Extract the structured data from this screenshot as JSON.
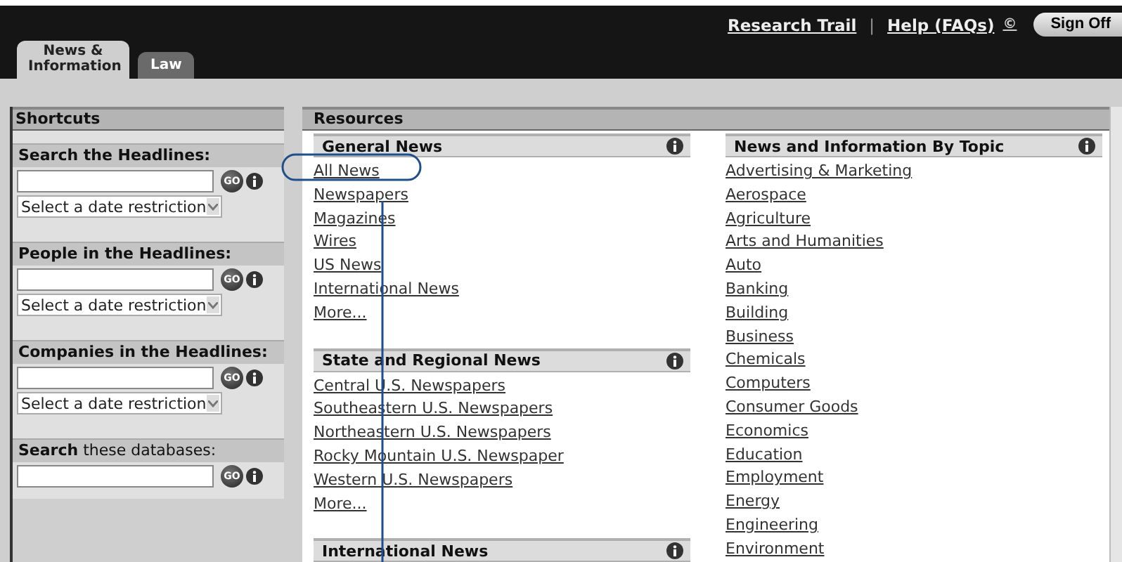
{
  "header": {
    "links": [
      {
        "label": "Research Trail"
      },
      {
        "label": "Help (FAQs)"
      }
    ],
    "separator": "|",
    "help_mark": "©",
    "sign_off": "Sign Off"
  },
  "tabs": [
    {
      "label": "News & Information",
      "selected": true
    },
    {
      "label": "Law",
      "selected": false
    }
  ],
  "shortcuts": {
    "title": "Shortcuts",
    "sections": [
      {
        "label": "Search the Headlines:",
        "go": "GO",
        "date_select": "Select a date restriction"
      },
      {
        "label": "People in the Headlines:",
        "go": "GO",
        "date_select": "Select a date restriction"
      },
      {
        "label": "Companies in the Headlines:",
        "go": "GO",
        "date_select": "Select a date restriction"
      },
      {
        "label": "**Search** these databases:",
        "go": "GO"
      }
    ]
  },
  "resources": {
    "title": "Resources",
    "columns": [
      [
        {
          "title": "General News",
          "links": [
            "All News",
            "Newspapers",
            "Magazines",
            "Wires",
            "US News",
            "International News",
            "More..."
          ]
        },
        {
          "title": "State and Regional News",
          "links": [
            "Central U.S. Newspapers",
            "Southeastern U.S. Newspapers",
            "Northeastern U.S. Newspapers",
            "Rocky Mountain U.S. Newspaper",
            "Western U.S. Newspapers",
            "More..."
          ]
        },
        {
          "title": "International News"
        }
      ],
      [
        {
          "title": "News and Information By Topic",
          "links": [
            "Advertising & Marketing",
            "Aerospace",
            "Agriculture",
            "Arts and Humanities",
            "Auto",
            "Banking",
            "Building",
            "Business",
            "Chemicals",
            "Computers",
            "Consumer Goods",
            "Economics",
            "Education",
            "Employment",
            "Energy",
            "Engineering",
            "Environment"
          ]
        }
      ]
    ]
  }
}
